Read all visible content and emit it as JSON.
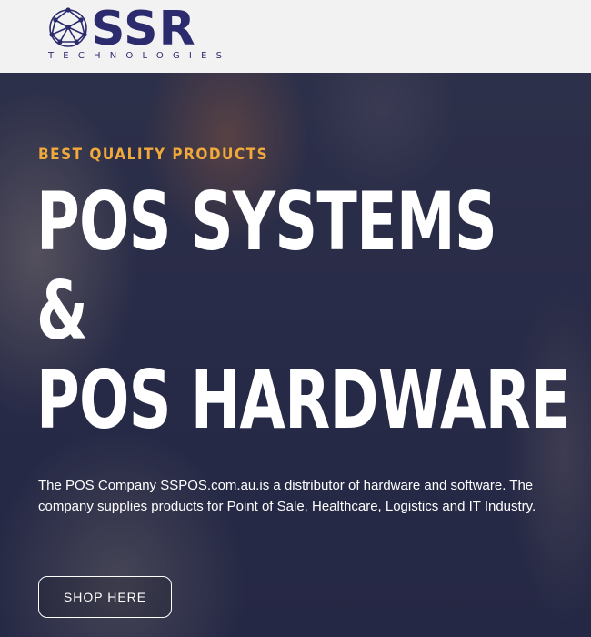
{
  "header": {
    "logo": {
      "icon": "network-globe-icon",
      "wordmark": "SSR",
      "tagline": "TECHNOLOGIES",
      "color": "#2b2b6e"
    }
  },
  "hero": {
    "eyebrow": "BEST QUALITY PRODUCTS",
    "headline": {
      "line1": "POS SYSTEMS",
      "line2": "&",
      "line3": "POS HARDWARE"
    },
    "description": "The POS Company SSPOS.com.au.is a distributor of hardware and software. The company supplies products for Point of Sale, Healthcare, Logistics and IT Industry.",
    "cta_label": "SHOP HERE",
    "colors": {
      "eyebrow": "#f0a93a",
      "headline": "#ffffff",
      "overlay": "#2e3250"
    }
  }
}
